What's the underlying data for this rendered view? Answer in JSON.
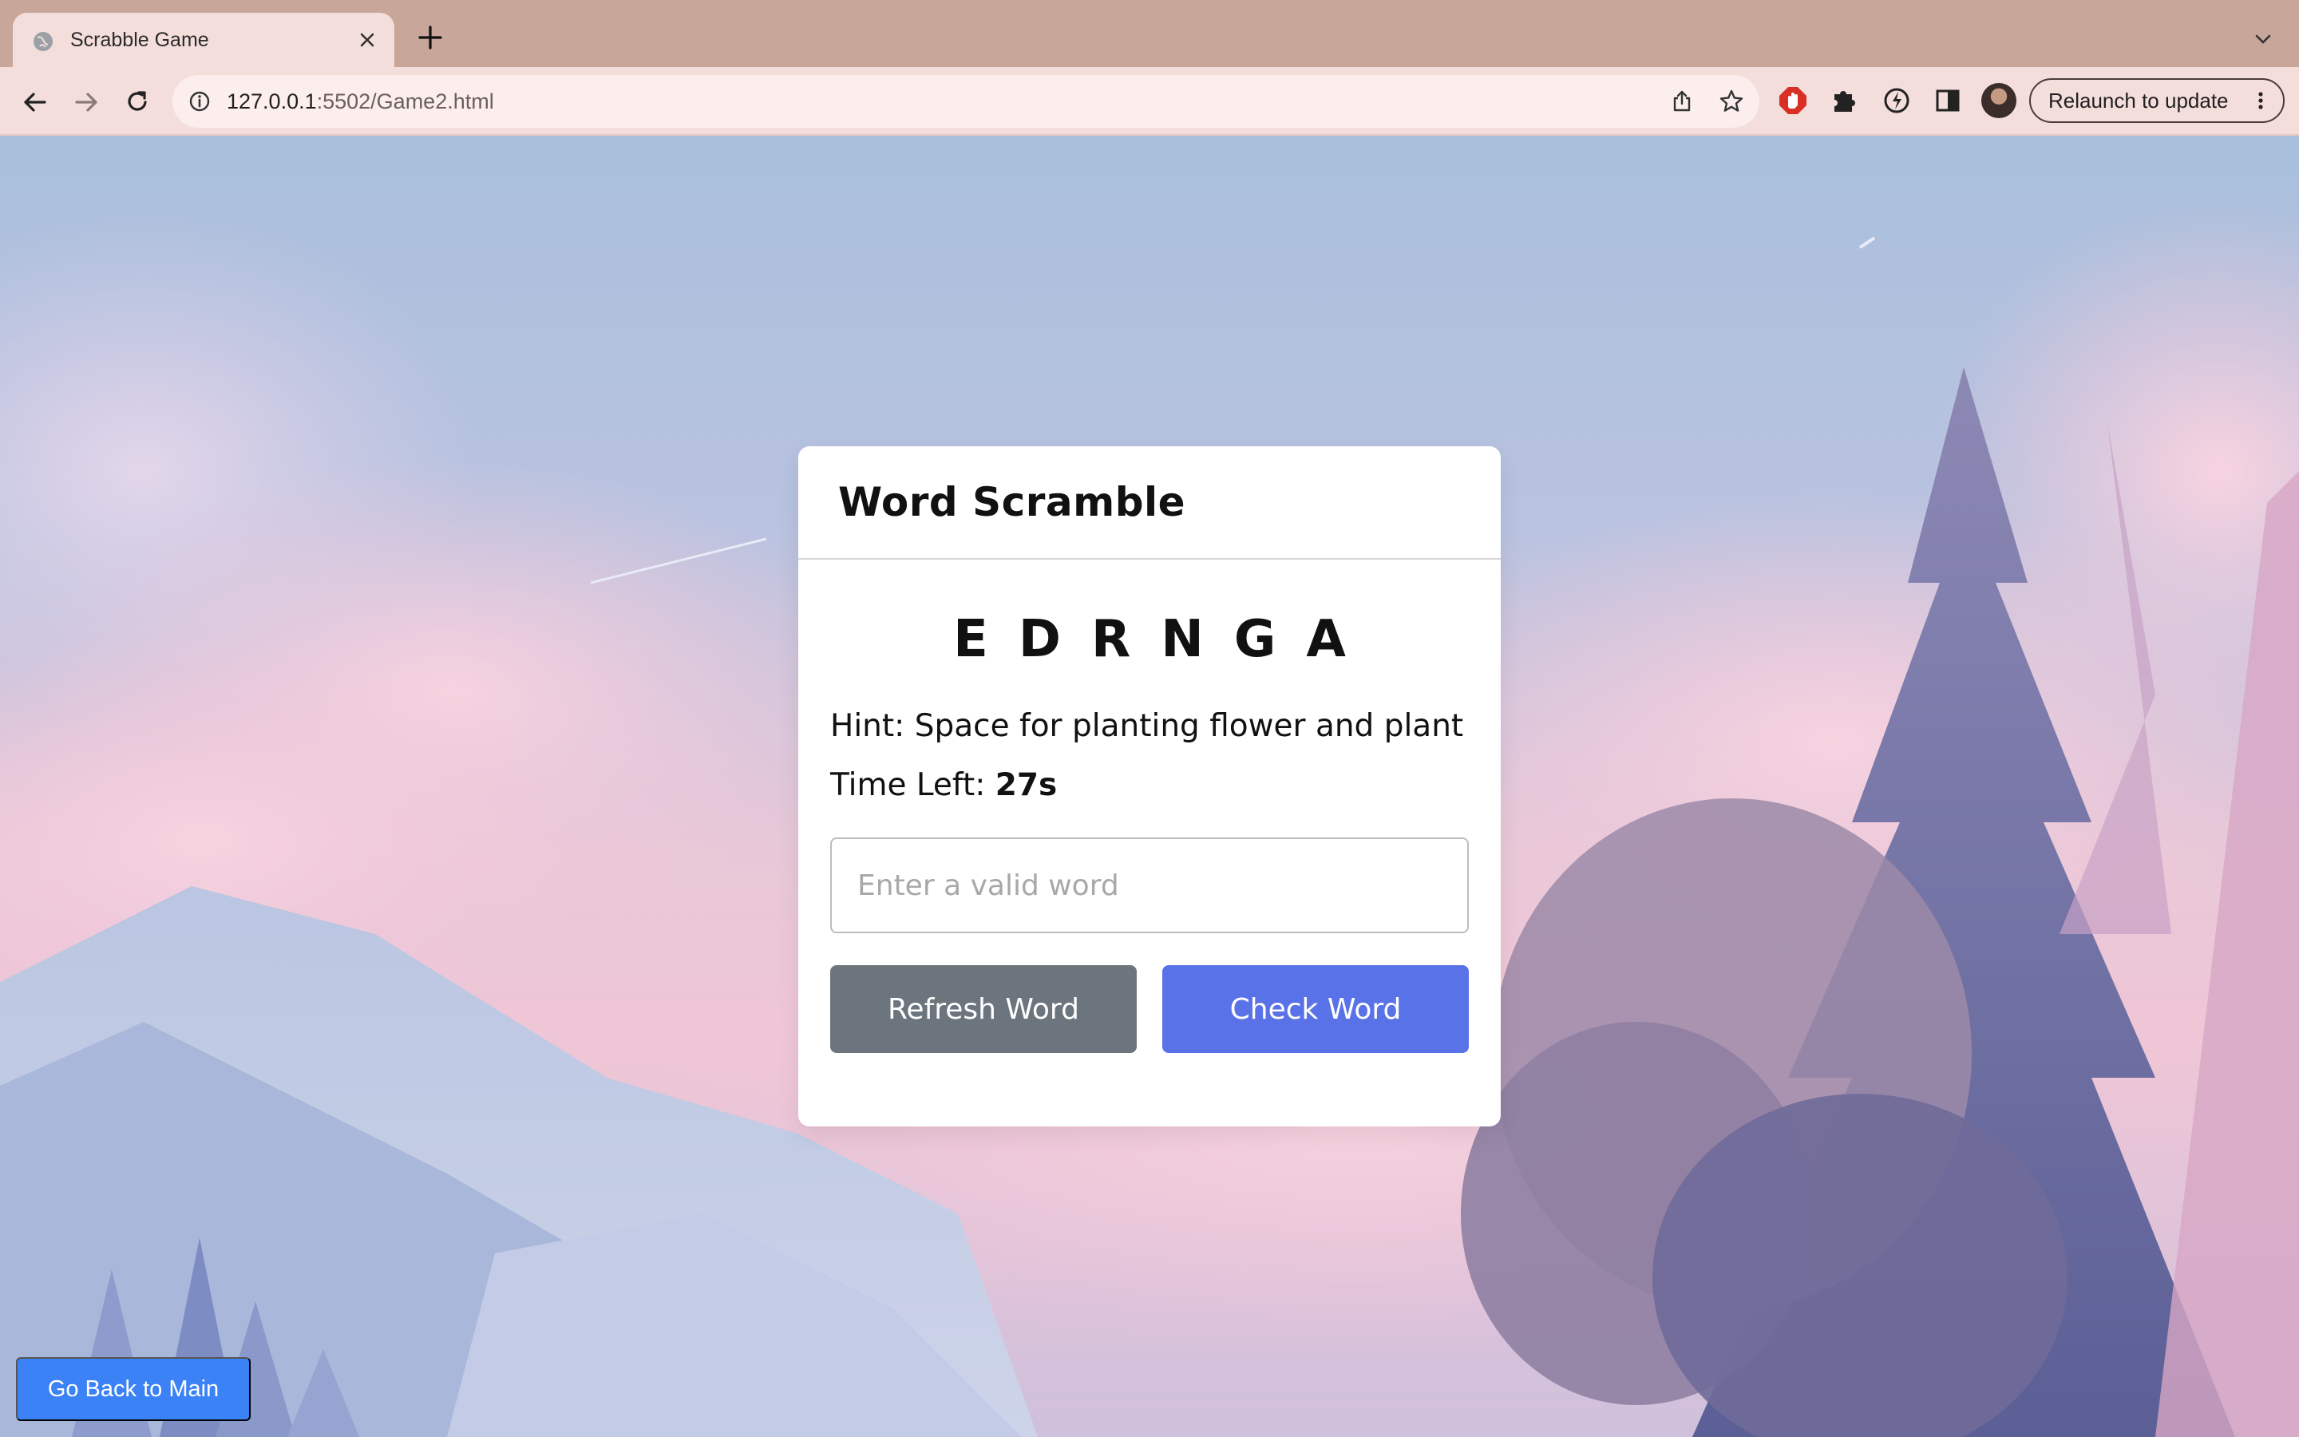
{
  "browser": {
    "tab_title": "Scrabble Game",
    "url_host": "127.0.0.1",
    "url_path": ":5502/Game2.html",
    "relaunch_label": "Relaunch to update",
    "icons": [
      "globe-icon",
      "close-icon",
      "plus-icon",
      "chevron-down-icon",
      "back-arrow-icon",
      "forward-arrow-icon",
      "reload-icon",
      "info-icon",
      "share-icon",
      "star-icon",
      "adblock-extension-icon",
      "puzzle-extension-icon",
      "sync-extension-icon",
      "sidepanel-icon",
      "kebab-menu-icon"
    ]
  },
  "game": {
    "title": "Word Scramble",
    "scrambled_letters": "EDRNGA",
    "hint_label": "Hint:",
    "hint_text": "Space for planting flower and plant",
    "time_label": "Time Left:",
    "time_value": "27s",
    "input_placeholder": "Enter a valid word",
    "input_value": "",
    "refresh_label": "Refresh Word",
    "check_label": "Check Word",
    "back_label": "Go Back to Main"
  },
  "colors": {
    "refresh_button": "#6c757d",
    "check_button": "#5a72e8",
    "back_button": "#3b82f6",
    "browser_frame": "#c8a69a"
  }
}
